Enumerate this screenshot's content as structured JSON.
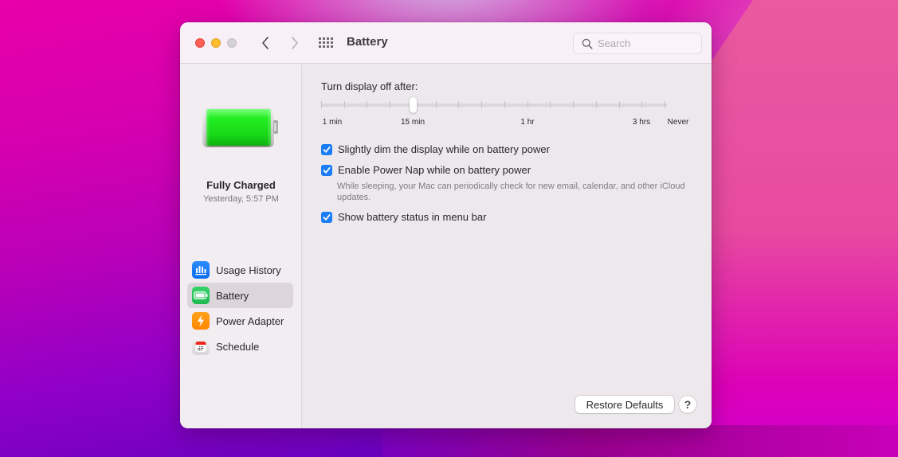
{
  "window": {
    "title": "Battery",
    "search_placeholder": "Search",
    "search_value": ""
  },
  "sidebar": {
    "status_title": "Fully Charged",
    "status_time": "Yesterday, 5:57 PM",
    "battery_icon": "battery-full-icon",
    "items": [
      {
        "label": "Usage History",
        "icon": "bar-chart-icon",
        "active": false
      },
      {
        "label": "Battery",
        "icon": "battery-icon",
        "active": true
      },
      {
        "label": "Power Adapter",
        "icon": "lightning-icon",
        "active": false
      },
      {
        "label": "Schedule",
        "icon": "calendar-icon",
        "active": false
      }
    ]
  },
  "display_off": {
    "label": "Turn display off after:",
    "tick_count": 16,
    "selected_index": 4,
    "selected_value": "15 min",
    "tick_labels": [
      {
        "text": "1 min",
        "index": 0
      },
      {
        "text": "15 min",
        "index": 4
      },
      {
        "text": "1 hr",
        "index": 9
      },
      {
        "text": "3 hrs",
        "index": 14
      },
      {
        "text": "Never",
        "index": 15
      }
    ]
  },
  "options": [
    {
      "label": "Slightly dim the display while on battery power",
      "checked": true
    },
    {
      "label": "Enable Power Nap while on battery power",
      "checked": true,
      "description": "While sleeping, your Mac can periodically check for new email, calendar, and other iCloud updates."
    },
    {
      "label": "Show battery status in menu bar",
      "checked": true
    }
  ],
  "footer": {
    "restore_label": "Restore Defaults",
    "help_label": "?"
  },
  "colors": {
    "accent": "#1a7cf6",
    "battery_green": "#22dd22"
  }
}
